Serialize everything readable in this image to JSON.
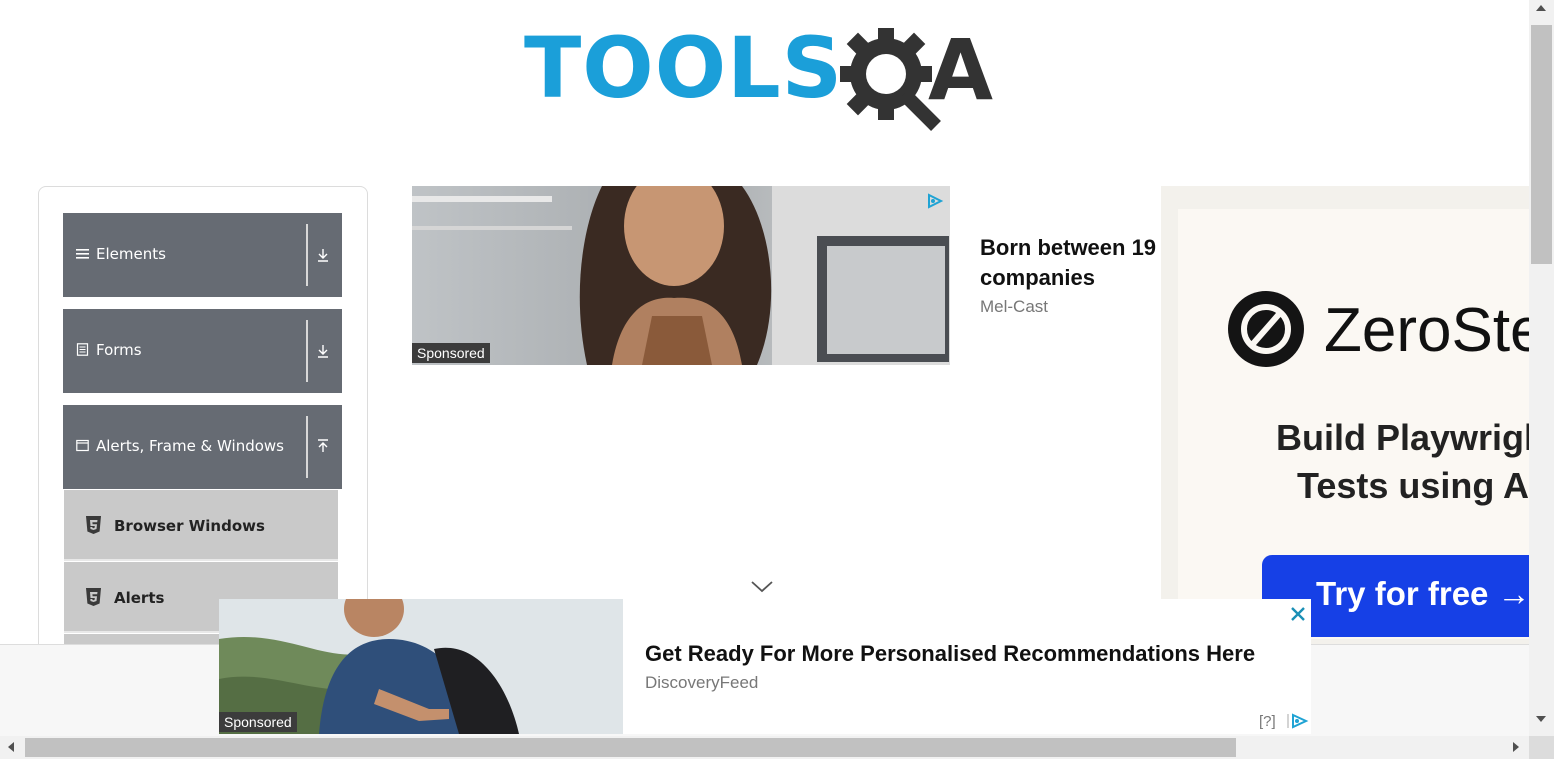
{
  "logo": {
    "text_tools": "TOOLS",
    "text_a": "A",
    "icon": "gear-magnifier-icon"
  },
  "sidebar": {
    "groups": [
      {
        "label": "Elements",
        "icon": "hamburger-icon",
        "arrow": "download-arrow-icon"
      },
      {
        "label": "Forms",
        "icon": "document-icon",
        "arrow": "download-arrow-icon"
      },
      {
        "label": "Alerts, Frame & Windows",
        "icon": "window-icon",
        "arrow": "upload-arrow-icon"
      }
    ],
    "items": [
      {
        "label": "Browser Windows",
        "icon": "html5-icon"
      },
      {
        "label": "Alerts",
        "icon": "html5-icon"
      }
    ]
  },
  "center_ad": {
    "sponsored": "Sponsored",
    "headline_line1": "Born between 19",
    "headline_line2": "companies",
    "source": "Mel-Cast"
  },
  "right_ad": {
    "brand": "ZeroSte",
    "tagline_line1": "Build Playwrigh",
    "tagline_line2": "Tests using A",
    "cta": "Try for free →"
  },
  "bottom_ad": {
    "sponsored": "Sponsored",
    "headline": "Get Ready For More Personalised Recommendations Here",
    "source": "DiscoveryFeed",
    "help": "[?]"
  },
  "colors": {
    "brand_blue": "#1b9fd9",
    "sidebar_header": "#666b73",
    "cta_blue": "#1640e6"
  }
}
